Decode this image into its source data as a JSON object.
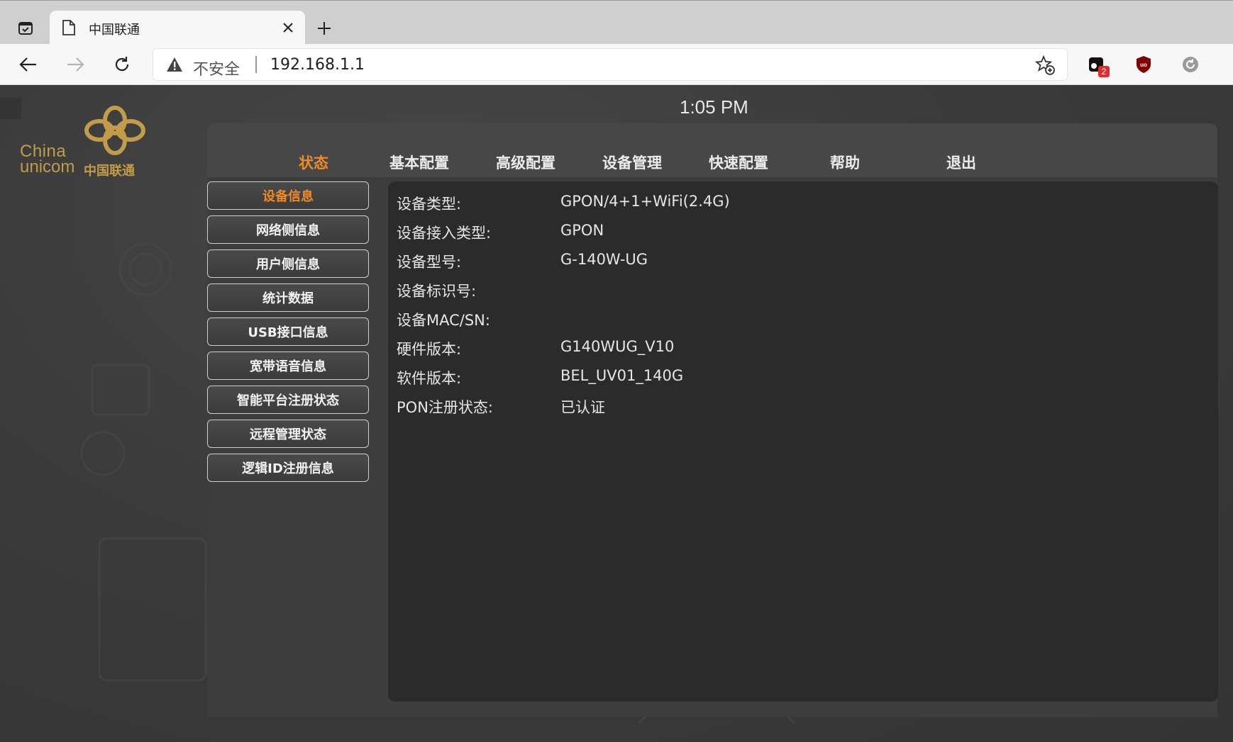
{
  "browser": {
    "tab_title": "中国联通",
    "insecure_label": "不安全",
    "url": "192.168.1.1",
    "extension_badge": "2"
  },
  "page": {
    "logo": {
      "line1": "China",
      "line2": "unicom",
      "cn": "中国联通",
      "color": "#c39c49"
    },
    "clock": "1:05 PM",
    "accent_color": "#f08a24",
    "top_nav": [
      {
        "label": "状态",
        "active": true
      },
      {
        "label": "基本配置",
        "active": false
      },
      {
        "label": "高级配置",
        "active": false
      },
      {
        "label": "设备管理",
        "active": false
      },
      {
        "label": "快速配置",
        "active": false
      },
      {
        "label": "帮助",
        "active": false
      },
      {
        "label": "退出",
        "active": false
      }
    ],
    "side_menu": [
      {
        "label": "设备信息",
        "active": true
      },
      {
        "label": "网络侧信息",
        "active": false
      },
      {
        "label": "用户侧信息",
        "active": false
      },
      {
        "label": "统计数据",
        "active": false
      },
      {
        "label": "USB接口信息",
        "active": false
      },
      {
        "label": "宽带语音信息",
        "active": false
      },
      {
        "label": "智能平台注册状态",
        "active": false
      },
      {
        "label": "远程管理状态",
        "active": false
      },
      {
        "label": "逻辑ID注册信息",
        "active": false
      }
    ],
    "device_info": [
      {
        "label": "设备类型:",
        "value": "GPON/4+1+WiFi(2.4G)"
      },
      {
        "label": "设备接入类型:",
        "value": "GPON"
      },
      {
        "label": "设备型号:",
        "value": "G-140W-UG"
      },
      {
        "label": "设备标识号:",
        "value": ""
      },
      {
        "label": "设备MAC/SN:",
        "value": ""
      },
      {
        "label": "硬件版本:",
        "value": "G140WUG_V10"
      },
      {
        "label": "软件版本:",
        "value": "BEL_UV01_140G"
      },
      {
        "label": "PON注册状态:",
        "value": "已认证"
      }
    ]
  }
}
